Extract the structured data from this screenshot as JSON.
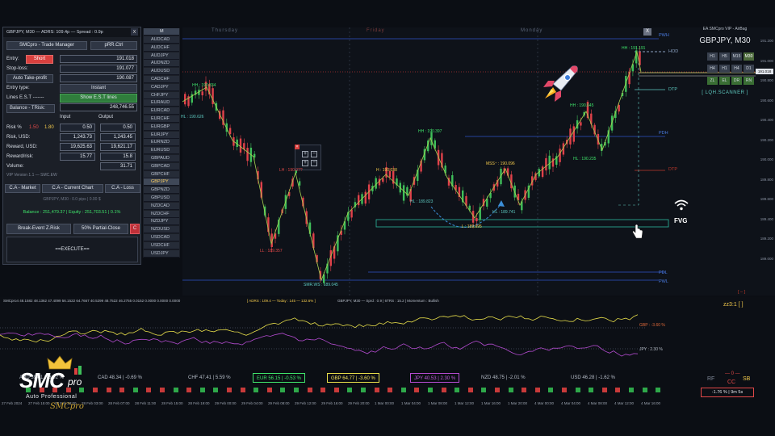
{
  "panel": {
    "title": "GBPJPY, M30 — ADRS: 109.4p — Spread : 0.9p",
    "close": "x",
    "tab_manager": "SMCpro - Trade Manager",
    "tab_prr": "pRR.Ctrl",
    "entry_label": "Entry:",
    "entry_side": "Short",
    "entry_value": "191.018",
    "stoploss_label": "Stop-loss:",
    "stoploss_value": "191.077",
    "autotp_label": "Auto Take-profit",
    "autotp_value": "190.087",
    "entrytype_label": "Entry type:",
    "entrytype_value": "Instant",
    "lines_label": "Lines E.S.T -------",
    "lines_button": "Show E.S.T lines",
    "balance_label": "Balance - TRisk:",
    "balance_value": "248,746.55",
    "col_input": "Input",
    "col_output": "Output",
    "risk_label": "Risk %",
    "risk_a": "1.50",
    "risk_b": "1.80",
    "risk_in": "0.50",
    "risk_out": "0.50",
    "riskusd_label": "Risk, USD:",
    "riskusd_in": "1,243.73",
    "riskusd_out": "1,243.45",
    "reward_label": "Reward, USD:",
    "reward_in": "19,625.63",
    "reward_out": "19,621.17",
    "rr_label": "Reward/risk:",
    "rr_in": "15.77",
    "rr_out": "15.8",
    "volume_label": "Volume:",
    "volume_out": "31.71",
    "version": "VIP Version 1.1 — SMC.EW",
    "ca_market": "C.A - Market",
    "ca_current": "C.A - Current Chart",
    "ca_loss": "C.A - Loss",
    "pos_line": "GBPJPY, M30 : 0.0 pips | 0.00 $",
    "equity_line": "Balance : 251,479.37 | Equity : 251,703.51 | 0.1%",
    "breakeven": "Break-Event Z.Risk",
    "partial": "50% Partial-Close",
    "close_c": "C",
    "execute": "==EXECUTE=="
  },
  "symbols": {
    "header": "M",
    "items": [
      "AUDCAD",
      "AUDCHF",
      "AUDJPY",
      "AUDNZD",
      "AUDUSD",
      "CADCHF",
      "CADJPY",
      "CHFJPY",
      "EURAUD",
      "EURCAD",
      "EURCHF",
      "EURGBP",
      "EURJPY",
      "EURNZD",
      "EURUSD",
      "GBPAUD",
      "GBPCAD",
      "GBPCHF",
      "GBPJPY",
      "GBPNZD",
      "GBPUSD",
      "NZDCAD",
      "NZDCHF",
      "NZDJPY",
      "NZDUSD",
      "USDCAD",
      "USDCHF",
      "USDJPY"
    ],
    "selected": "GBPJPY"
  },
  "chart": {
    "days": [
      "Thursday",
      "Friday",
      "Monday"
    ],
    "close_x": "X",
    "ea_title": "EA SMCpro VIP - AirBag",
    "pair_title": "GBPJPY, M30",
    "scanner": "[ LQH.SCANNER ]",
    "timeframes": [
      "H1",
      "H5",
      "M15",
      "M30",
      "H4",
      "H1",
      "H4",
      "D1",
      "ZL",
      "EL",
      "DR",
      "RN"
    ],
    "tf_on": "M30",
    "levels": {
      "pwh": "PWH",
      "hod": "HOD",
      "dtp1": "DTP",
      "pdh": "PDH",
      "dtp2": "DTP",
      "pdl": "PDL",
      "pwl": "PWL"
    },
    "fvg": "FVG",
    "y_labels": [
      "191.200",
      "191.000",
      "190.800",
      "190.600",
      "190.400",
      "190.200",
      "190.000",
      "189.800",
      "189.600",
      "189.400",
      "189.200",
      "189.000"
    ],
    "price_tag": "191.018",
    "annotations": [
      {
        "text": "HH : 190.834",
        "color": "#3fe36a"
      },
      {
        "text": "HL : 190.626",
        "color": "#5ec9c0"
      },
      {
        "text": "LH : 190.0??",
        "color": "#e14848"
      },
      {
        "text": "LL : 189.357",
        "color": "#e14848"
      },
      {
        "text": "SMR.WS : 189.045",
        "color": "#5ec9c0"
      },
      {
        "text": "H : 190.038",
        "color": "#f2c94c"
      },
      {
        "text": "HL : 189.823",
        "color": "#5ec9c0"
      },
      {
        "text": "HH : 190.397",
        "color": "#3fe36a"
      },
      {
        "text": "L : 189.695",
        "color": "#f2c94c"
      },
      {
        "text": "MSS⁺ : 190.096",
        "color": "#f2c94c"
      },
      {
        "text": "HL : 189.741",
        "color": "#5ec9c0"
      },
      {
        "text": "HH : 190.645",
        "color": "#3fe36a"
      },
      {
        "text": "HL : 190.235",
        "color": "#3fe36a"
      },
      {
        "text": "HH : 191.191",
        "color": "#3fe36a"
      }
    ],
    "corner_mark": "[ – ]"
  },
  "osc": {
    "header": "SMCpro4 48.1582 48.1362 47.4099 56.1522 64.7667 40.5299 48.7522 46.2755 0.0152 0.0000 0.0000 0.0000",
    "header2": "[ ADRS : 109.4 — Today : 145 — 132.6% ]",
    "header3": "GBPJPY, M30 — Sprd : 0.9 | 6TRS : 15.2 | Momentum : Bullish",
    "top_right": "zz3:1 [ ]",
    "gbp_label": "GBP : -3.60 %",
    "jpy_label": "JPY : 2.30 %"
  },
  "currencies": [
    {
      "text": "AUD 39.41 | -3.62 %",
      "color": "#b7bec9"
    },
    {
      "text": "CAD 48.34 | -0.69 %",
      "color": "#b7bec9"
    },
    {
      "text": "CHF 47.41 | 5.59 %",
      "color": "#b7bec9"
    },
    {
      "text": "EUR 56.15 | -0.53 %",
      "color": "#3fe36a"
    },
    {
      "text": "GBP 64.77 | -3.60 %",
      "color": "#f2e15c"
    },
    {
      "text": "JPY 40.53 | 2.30 %",
      "color": "#c05cd8"
    },
    {
      "text": "NZD 48.75 | -2.01 %",
      "color": "#b7bec9"
    },
    {
      "text": "USD 46.28 | -1.62 %",
      "color": "#b7bec9"
    }
  ],
  "bottom_right": {
    "rf": "RF",
    "sb": "SB",
    "cc": "CC",
    "dash": "— 0 —",
    "pct": "-1.76 % | 9m 5s"
  },
  "logo": {
    "main": "SMC",
    "pro": "pro",
    "sub": "Auto Professional",
    "sig": "SMCpro"
  },
  "x_labels": [
    "27 Feb 2024",
    "27 Feb 15:00",
    "27 Feb 23:00",
    "28 Feb 03:00",
    "28 Feb 07:00",
    "28 Feb 11:00",
    "28 Feb 15:00",
    "28 Feb 19:00",
    "29 Feb 00:00",
    "29 Feb 04:00",
    "29 Feb 08:00",
    "29 Feb 12:00",
    "29 Feb 16:00",
    "29 Feb 20:00",
    "1 Mar 00:00",
    "1 Mar 04:00",
    "1 Mar 08:00",
    "1 Mar 12:00",
    "1 Mar 16:00",
    "1 Mar 20:00",
    "4 Mar 00:00",
    "4 Mar 04:00",
    "4 Mar 08:00",
    "4 Mar 12:00",
    "4 Mar 16:00"
  ]
}
